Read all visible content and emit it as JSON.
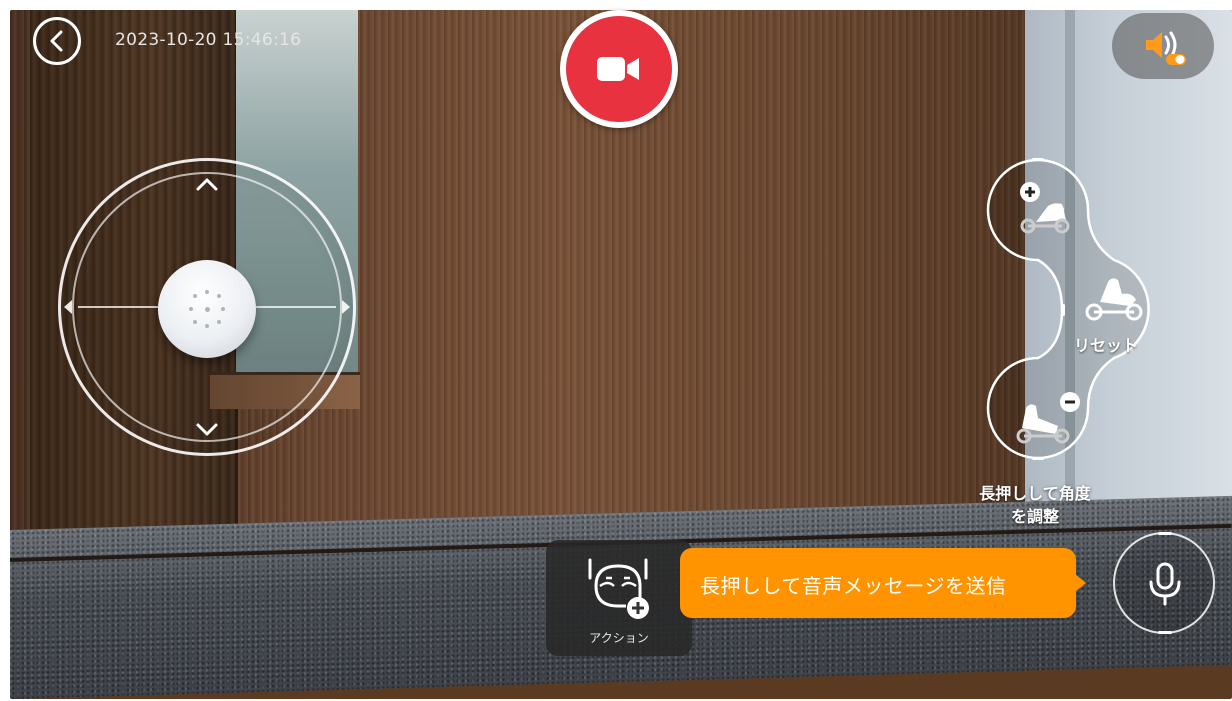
{
  "header": {
    "back_icon": "chevron-left-icon",
    "timestamp": "2023-10-20 15:46:16"
  },
  "record": {
    "icon": "video-camera-icon",
    "color": "#e8323f"
  },
  "sound": {
    "icon": "speaker-toggle-icon",
    "accent": "#ff9400"
  },
  "joystick": {
    "up_icon": "chevron-up-icon",
    "down_icon": "chevron-down-icon"
  },
  "angle_control": {
    "increase_icon": "angle-up-plus-icon",
    "reset_icon": "angle-reset-icon",
    "decrease_icon": "angle-down-minus-icon",
    "reset_label": "リセット",
    "hint_line1": "長押しして角度",
    "hint_line2": "を調整"
  },
  "action": {
    "icon": "face-add-icon",
    "label": "アクション"
  },
  "voice": {
    "tooltip": "長押しして音声メッセージを送信",
    "tooltip_color": "#ff9400",
    "mic_icon": "microphone-icon"
  }
}
